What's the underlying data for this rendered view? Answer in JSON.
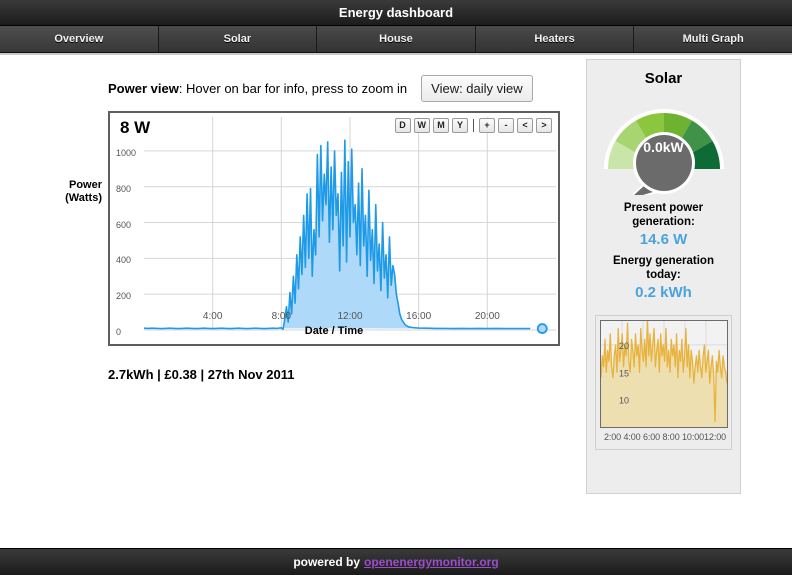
{
  "header": {
    "title": "Energy dashboard"
  },
  "tabs": [
    {
      "label": "Overview",
      "active": true
    },
    {
      "label": "Solar",
      "active": false
    },
    {
      "label": "House",
      "active": false
    },
    {
      "label": "Heaters",
      "active": false
    },
    {
      "label": "Multi Graph",
      "active": false
    }
  ],
  "power_view": {
    "caption_bold": "Power view",
    "caption_rest": ": Hover on bar for info, press to zoom in",
    "view_button": "View: daily view",
    "current_value_label": "8 W",
    "zoom_buttons": [
      "D",
      "W",
      "M",
      "Y",
      "+",
      "-",
      "<",
      ">"
    ],
    "summary": "2.7kWh | £0.38 | 27th Nov 2011",
    "line_color": "#1e9ae8",
    "fill_color": "#aed9f8"
  },
  "solar": {
    "title": "Solar",
    "gauge_value": "0.0kW",
    "gauge_colors": [
      "#c9e6a8",
      "#a8d472",
      "#8cc63f",
      "#6eb231",
      "#3f9247",
      "#0f6b35"
    ],
    "gauge_center_color": "#6b6b6b",
    "present_label": "Present power generation:",
    "present_value": "14.6 W",
    "today_label": "Energy generation today:",
    "today_value": "0.2 kWh",
    "value_color": "#4aa3df",
    "mini_chart_xlabels": "2:00 4:00 6:00 8:00 10:0012:00"
  },
  "footer": {
    "text": "powered by",
    "link": "openenergymonitor.org",
    "link_color": "#9b4dca"
  },
  "chart_data": {
    "type": "area",
    "title": "Power view",
    "xlabel": "Date / Time",
    "ylabel": "Power (Watts)",
    "ylim": [
      0,
      1100
    ],
    "yticks": [
      0,
      200,
      400,
      600,
      800,
      1000
    ],
    "xlim": [
      0,
      24
    ],
    "xticks": [
      4,
      8,
      12,
      16,
      20
    ],
    "xticklabels": [
      "4:00",
      "8:00",
      "12:00",
      "16:00",
      "20:00"
    ],
    "grid": true,
    "legend": "none",
    "current_marker": {
      "x": 23.2,
      "y": 8,
      "label": "8 W"
    },
    "series": [
      {
        "name": "Power (Watts)",
        "line_color": "#1e9ae8",
        "fill_color": "#aed9f8",
        "x": [
          0.0,
          0.25,
          0.5,
          0.75,
          1.0,
          1.25,
          1.5,
          1.75,
          2.0,
          2.25,
          2.5,
          2.75,
          3.0,
          3.25,
          3.5,
          3.75,
          4.0,
          4.25,
          4.5,
          4.75,
          5.0,
          5.25,
          5.5,
          5.75,
          6.0,
          6.25,
          6.5,
          6.75,
          7.0,
          7.25,
          7.5,
          7.75,
          8.0,
          8.1,
          8.2,
          8.3,
          8.4,
          8.5,
          8.6,
          8.7,
          8.8,
          8.9,
          9.0,
          9.1,
          9.2,
          9.3,
          9.4,
          9.5,
          9.6,
          9.7,
          9.8,
          9.9,
          10.0,
          10.1,
          10.2,
          10.3,
          10.4,
          10.5,
          10.6,
          10.7,
          10.8,
          10.9,
          11.0,
          11.1,
          11.2,
          11.3,
          11.4,
          11.5,
          11.6,
          11.7,
          11.8,
          11.9,
          12.0,
          12.1,
          12.2,
          12.3,
          12.4,
          12.5,
          12.6,
          12.7,
          12.8,
          12.9,
          13.0,
          13.1,
          13.2,
          13.3,
          13.4,
          13.5,
          13.6,
          13.7,
          13.8,
          13.9,
          14.0,
          14.1,
          14.2,
          14.3,
          14.4,
          14.5,
          14.6,
          14.7,
          14.8,
          14.9,
          15.0,
          15.2,
          15.4,
          15.6,
          15.8,
          16.0,
          16.5,
          17.0,
          17.5,
          18.0,
          18.5,
          19.0,
          19.5,
          20.0,
          20.5,
          21.0,
          21.5,
          22.0,
          22.5,
          23.0,
          23.2,
          23.5,
          24.0
        ],
        "y": [
          10,
          9,
          10,
          9,
          8,
          9,
          10,
          9,
          8,
          9,
          10,
          9,
          8,
          9,
          10,
          9,
          8,
          9,
          10,
          9,
          8,
          9,
          10,
          9,
          8,
          9,
          10,
          9,
          8,
          9,
          10,
          9,
          12,
          5,
          60,
          130,
          45,
          210,
          90,
          300,
          150,
          420,
          230,
          520,
          310,
          640,
          350,
          760,
          400,
          790,
          300,
          560,
          420,
          980,
          520,
          1030,
          610,
          870,
          700,
          1050,
          490,
          910,
          560,
          1000,
          640,
          760,
          330,
          880,
          470,
          1060,
          380,
          940,
          520,
          1010,
          600,
          700,
          420,
          820,
          360,
          900,
          470,
          640,
          300,
          780,
          390,
          560,
          260,
          700,
          330,
          480,
          220,
          600,
          290,
          420,
          180,
          520,
          250,
          360,
          310,
          200,
          150,
          90,
          60,
          30,
          18,
          14,
          12,
          11,
          10,
          9,
          9,
          8,
          9,
          8,
          9,
          8,
          9,
          8,
          8,
          8,
          8
        ]
      }
    ],
    "mini_chart": {
      "type": "area",
      "line_color": "#e8b33d",
      "fill_color": "#eedfb0",
      "yticks": [
        10,
        15,
        20
      ],
      "ylim": [
        5,
        24
      ],
      "xticklabels": [
        "2:00",
        "4:00",
        "6:00",
        "8:00",
        "10:00",
        "12:00"
      ],
      "y": [
        14,
        18,
        16,
        21,
        15,
        19,
        17,
        22,
        16,
        14,
        18,
        20,
        15,
        23,
        17,
        19,
        22,
        16,
        20,
        18,
        24,
        17,
        15,
        21,
        19,
        16,
        22,
        18,
        20,
        15,
        23,
        19,
        17,
        21,
        16,
        25,
        18,
        22,
        17,
        20,
        23,
        16,
        19,
        21,
        15,
        22,
        18,
        20,
        17,
        23,
        16,
        19,
        15,
        21,
        18,
        20,
        16,
        22,
        14,
        19,
        17,
        21,
        15,
        18,
        23,
        16,
        20,
        14,
        19,
        17,
        13,
        16,
        18,
        15,
        19,
        16,
        14,
        18,
        20,
        15,
        17,
        19,
        13,
        16,
        18,
        14,
        6,
        17,
        15,
        19,
        16,
        14,
        18,
        16,
        15,
        13
      ]
    }
  }
}
